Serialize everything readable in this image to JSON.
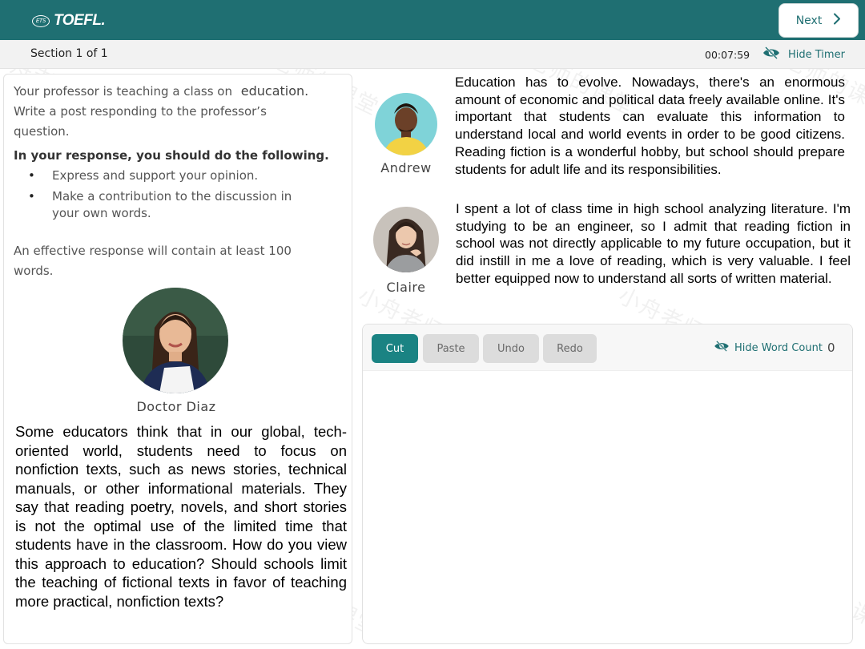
{
  "header": {
    "logo_badge": "ETS",
    "logo_text": "TOEFL.",
    "next_label": "Next"
  },
  "section_bar": {
    "section_label": "Section 1 of 1",
    "timer": "00:07:59",
    "hide_timer_label": "Hide Timer"
  },
  "prompt": {
    "intro_prefix": "Your professor is teaching a class on",
    "topic": "education.",
    "intro_suffix": "Write a post responding to the professor’s question.",
    "instructions_heading": "In your response, you should do the following.",
    "bullets": [
      "Express and support your opinion.",
      "Make a contribution to the discussion in your own words."
    ],
    "min_words": "An effective response will contain at least 100 words."
  },
  "professor": {
    "name": "Doctor Diaz",
    "question": "Some educators think that in our global, tech-oriented world, students need to focus on nonfiction texts, such as news stories, technical manuals, or other informational materials. They say that reading poetry, novels, and short stories is not the optimal use of the limited time that students have in the classroom. How do you view this approach to education? Should schools limit the teaching of fictional texts in favor of teaching more practical, nonfiction texts?"
  },
  "students": [
    {
      "name": "Andrew",
      "post": "Education has to evolve. Nowadays, there's an enormous amount of economic and political data freely available online. It's important that students can evaluate this information to understand local and world events in order to be good citizens. Reading fiction is a wonderful hobby, but school should prepare students for adult life and its responsibilities."
    },
    {
      "name": "Claire",
      "post": "I spent a lot of class time in high school analyzing literature. I'm studying to be an engineer, so I admit that reading fiction in school was not directly applicable to my future occupation, but it did instill in me a love of reading, which is very valuable. I feel better equipped now to understand all sorts of written material."
    }
  ],
  "editor": {
    "cut_label": "Cut",
    "paste_label": "Paste",
    "undo_label": "Undo",
    "redo_label": "Redo",
    "hide_word_count_label": "Hide Word Count",
    "word_count": "0",
    "response_text": ""
  },
  "watermark_text": "小舟老师的课堂",
  "colors": {
    "brand": "#1f6f72",
    "accent": "#1a8383",
    "disabled_button": "#dcdcdc"
  },
  "icons": {
    "next": "chevron-right-icon",
    "hide_timer": "eye-slash-icon",
    "hide_word_count": "eye-slash-icon"
  }
}
